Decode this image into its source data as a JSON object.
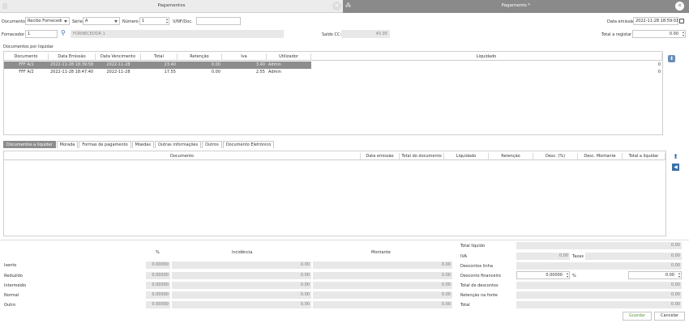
{
  "titlebar": {
    "left_title": "Pagamentos",
    "right_title": "Pagamento *",
    "close_glyph": "✕"
  },
  "header": {
    "documento_label": "Documento",
    "documento_value": "Recibo Fornecedi",
    "serie_label": "Série",
    "serie_value": "A",
    "numero_label": "Número",
    "numero_value": "1",
    "vnf_label": "V/NF/Doc.",
    "vnf_value": "",
    "data_emissao_label": "Data emissão",
    "data_emissao_value": "2022-11-28 18:59:01",
    "fornecedor_label": "Fornecedor",
    "fornecedor_value": "1",
    "fornecedor_nome": "FORNECEDOR 1",
    "saldo_label": "Saldo CC:",
    "saldo_value": "40.95",
    "total_registar_label": "Total a registar",
    "total_registar_value": "0.00"
  },
  "docs_section": {
    "title": "Documentos por liquidar",
    "columns": [
      "Documento",
      "Data Emissão",
      "Data Vencimento",
      "Total",
      "Retenção",
      "Iva",
      "Utilizador",
      "Liquidado"
    ],
    "rows": [
      {
        "documento": "FFF A/1",
        "emissao": "2022-11-28 18:39:58",
        "vencimento": "2022-11-28",
        "total": "23.40",
        "retencao": "0.00",
        "iva": "3.40",
        "utilizador": "Admin",
        "liquidado": "0"
      },
      {
        "documento": "FFF A/2",
        "emissao": "2022-11-28 18:47:40",
        "vencimento": "2022-11-28",
        "total": "17.55",
        "retencao": "0.00",
        "iva": "2.55",
        "utilizador": "Admin",
        "liquidado": "0"
      }
    ]
  },
  "tabs": [
    "Documentos a liquidar",
    "Morada",
    "Formas de pagamento",
    "Moedas",
    "Outras informações",
    "Outros",
    "Documento Eletrónico"
  ],
  "liquidar_table": {
    "columns": [
      "Documento",
      "Data emissão",
      "Total do documento",
      "Liquidado",
      "Retenção",
      "Desc. (%)",
      "Desc. Montante",
      "Total a liquidar"
    ]
  },
  "tax_table": {
    "col_pct": "%",
    "col_incidencia": "Incidência",
    "col_montante": "Montante",
    "rows": [
      {
        "label": "Isento",
        "pct": "0.00000",
        "incidencia": "0.00",
        "montante": "0.00"
      },
      {
        "label": "Reduzido",
        "pct": "0.00000",
        "incidencia": "0.00",
        "montante": "0.00"
      },
      {
        "label": "Intermédio",
        "pct": "0.00000",
        "incidencia": "0.00",
        "montante": "0.00"
      },
      {
        "label": "Normal",
        "pct": "0.00000",
        "incidencia": "0.00",
        "montante": "0.00"
      },
      {
        "label": "Outro",
        "pct": "0.00000",
        "incidencia": "0.00",
        "montante": "0.00"
      }
    ]
  },
  "totals": {
    "total_liquido_label": "Total líquido",
    "total_liquido_value": "0.00",
    "iva_label": "IVA",
    "iva_value": "0.00",
    "taxas_label": "Taxas",
    "taxas_value": "0.00",
    "descontos_linha_label": "Descontos linha",
    "descontos_linha_value": "0.00",
    "desconto_fin_label": "Desconto financeiro",
    "desconto_fin_pct": "0.00000",
    "pct_sign": "%",
    "desconto_fin_value": "0.00",
    "total_descontos_label": "Total de descontos",
    "total_descontos_value": "0.00",
    "retencao_label": "Retenção na fonte",
    "retencao_value": "0.00",
    "total_label": "Total",
    "total_value": "0.00"
  },
  "buttons": {
    "guardar": "Guardar",
    "cancelar": "Cancelar"
  },
  "colors": {
    "accent": "#6a8db5",
    "selected_row": "#8d8d8d",
    "guardar_text": "#5a9a3a"
  }
}
